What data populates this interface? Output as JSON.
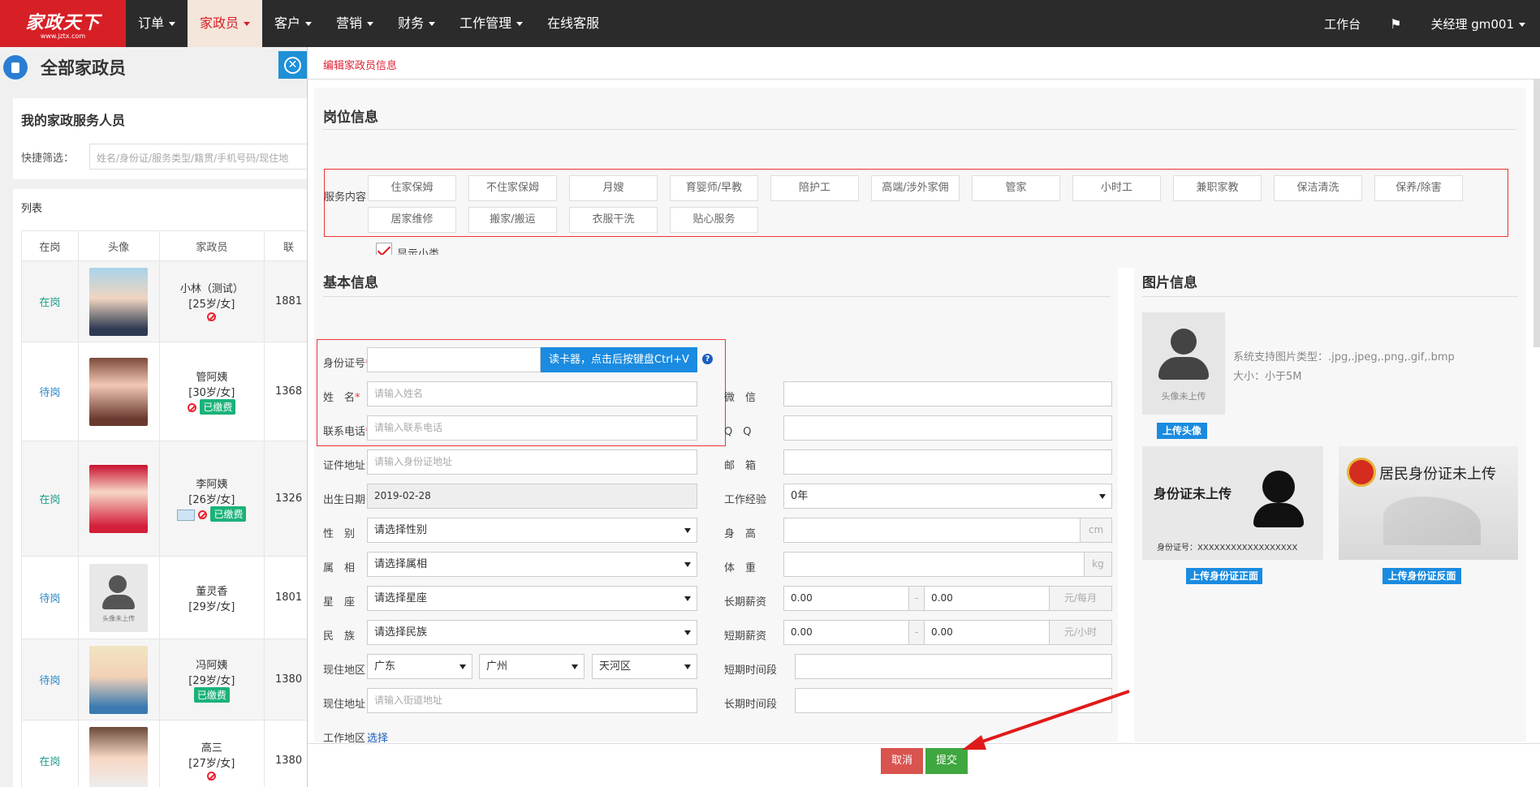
{
  "nav": {
    "logo_text": "家政天下",
    "logo_url": "www.jztx.com",
    "items": [
      {
        "label": "订单",
        "caret": true
      },
      {
        "label": "家政员",
        "caret": true,
        "active": true
      },
      {
        "label": "客户",
        "caret": true
      },
      {
        "label": "营销",
        "caret": true
      },
      {
        "label": "财务",
        "caret": true
      },
      {
        "label": "工作管理",
        "caret": true
      },
      {
        "label": "在线客服",
        "caret": false
      }
    ],
    "workbench": "工作台",
    "user": "关经理  gm001"
  },
  "left": {
    "title": "全部家政员",
    "card_title": "我的家政服务人员",
    "filter_label": "快捷筛选：",
    "filter_placeholder": "姓名/身份证/服务类型/籍贯/手机号码/现住地",
    "list_label": "列表",
    "columns": [
      "在岗",
      "头像",
      "家政员",
      "联"
    ],
    "rows": [
      {
        "status": "在岗",
        "name": "小林（测试）",
        "age": "[25岁/女]",
        "phone": "1881",
        "badge": "",
        "no": true
      },
      {
        "status": "待岗",
        "name": "管阿姨",
        "age": "[30岁/女]",
        "phone": "1368",
        "badge": "已缴费",
        "no": true
      },
      {
        "status": "在岗",
        "name": "李阿姨",
        "age": "[26岁/女]",
        "phone": "1326",
        "badge": "已缴费",
        "no": true
      },
      {
        "status": "待岗",
        "name": "董灵香",
        "age": "[29岁/女]",
        "phone": "1801",
        "badge": "",
        "no": false,
        "placeholder_text": "头像未上传"
      },
      {
        "status": "待岗",
        "name": "冯阿姨",
        "age": "[29岁/女]",
        "phone": "1380",
        "badge": "已缴费",
        "no": false
      },
      {
        "status": "在岗",
        "name": "高三",
        "age": "[27岁/女]",
        "phone": "1380",
        "badge": "",
        "no": true
      }
    ]
  },
  "panel": {
    "header": "编辑家政员信息",
    "post_section": {
      "title": "岗位信息",
      "service_label": "服务内容",
      "services": [
        "住家保姆",
        "不住家保姆",
        "月嫂",
        "育婴师/早教",
        "陪护工",
        "高端/涉外家佣",
        "管家",
        "小时工",
        "兼职家教",
        "保洁清洗",
        "保养/除害",
        "居家维修",
        "搬家/搬运",
        "衣服干洗",
        "贴心服务"
      ],
      "show_sub": "显示小类"
    },
    "basic_section": {
      "title": "基本信息",
      "id_label": "身份证号",
      "read_card": "读卡器，点击后按键盘Ctrl+V",
      "name_label": "姓　名",
      "name_ph": "请输入姓名",
      "phone_label": "联系电话",
      "phone_ph": "请输入联系电话",
      "addr_label": "证件地址",
      "addr_ph": "请输入身份证地址",
      "birth_label": "出生日期",
      "birth_val": "2019-02-28",
      "gender_label": "性　别",
      "gender_val": "请选择性别",
      "zodiac_label": "属　相",
      "zodiac_val": "请选择属相",
      "star_label": "星　座",
      "star_val": "请选择星座",
      "nation_label": "民　族",
      "nation_val": "请选择民族",
      "region_label": "现住地区",
      "province": "广东",
      "city": "广州",
      "district": "天河区",
      "curaddr_label": "现住地址",
      "curaddr_ph": "请输入街道地址",
      "workarea_label": "工作地区",
      "workarea_link": "选择",
      "wechat_label": "微　信",
      "qq_label": "Q　Q",
      "email_label": "邮　箱",
      "exp_label": "工作经验",
      "exp_val": "0年",
      "height_label": "身　高",
      "height_unit": "cm",
      "weight_label": "体　重",
      "weight_unit": "kg",
      "long_sal_label": "长期薪资",
      "long_sal_from": "0.00",
      "long_sal_to": "0.00",
      "long_sal_unit": "元/每月",
      "short_sal_label": "短期薪资",
      "short_sal_from": "0.00",
      "short_sal_to": "0.00",
      "short_sal_unit": "元/小时",
      "dash": "-",
      "short_time_label": "短期时间段",
      "long_time_label": "长期时间段"
    },
    "image_section": {
      "title": "图片信息",
      "avatar_text": "头像未上传",
      "support_text": "系统支持图片类型：.jpg,.jpeg,.png,.gif,.bmp",
      "size_text": "大小：小于5M",
      "upload_avatar": "上传头像",
      "id_front_title": "身份证未上传",
      "id_front_no": "身份证号：XXXXXXXXXXXXXXXXXX",
      "id_back_title": "居民身份证未上传",
      "upload_front": "上传身份证正面",
      "upload_back": "上传身份证反面"
    },
    "cancel": "取消",
    "submit": "提交"
  }
}
